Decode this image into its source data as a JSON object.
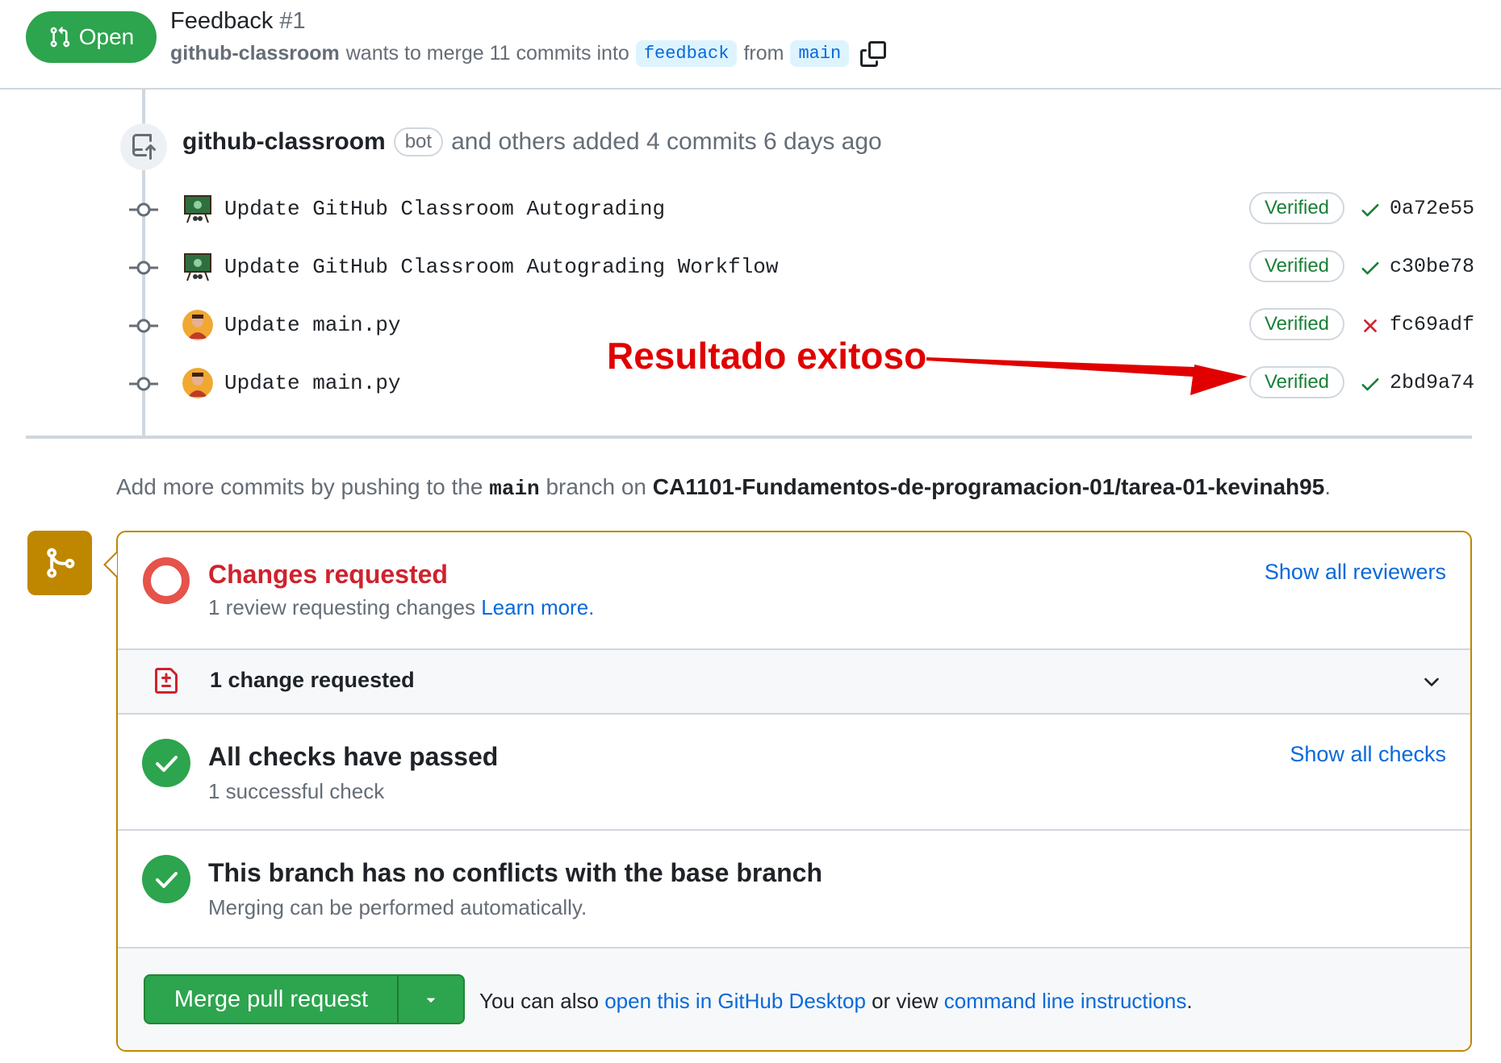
{
  "header": {
    "state_label": "Open",
    "title": "Feedback",
    "number": "#1",
    "author": "github-classroom",
    "meta_text": "wants to merge 11 commits into",
    "base_branch": "feedback",
    "from_text": "from",
    "head_branch": "main"
  },
  "timeline": {
    "push_author": "github-classroom",
    "bot_label": "bot",
    "push_summary": "and others added 4 commits 6 days ago",
    "commits": [
      {
        "message": "Update GitHub Classroom Autograding",
        "verified": "Verified",
        "status": "success",
        "sha": "0a72e55"
      },
      {
        "message": "Update GitHub Classroom Autograding Workflow",
        "verified": "Verified",
        "status": "success",
        "sha": "c30be78"
      },
      {
        "message": "Update main.py",
        "verified": "Verified",
        "status": "failure",
        "sha": "fc69adf"
      },
      {
        "message": "Update main.py",
        "verified": "Verified",
        "status": "success",
        "sha": "2bd9a74"
      }
    ]
  },
  "annotation": {
    "text": "Resultado exitoso",
    "color": "#e00000"
  },
  "add_more": {
    "prefix": "Add more commits by pushing to the",
    "branch": "main",
    "middle": "branch on",
    "repo": "CA1101-Fundamentos-de-programacion-01/tarea-01-kevinah95",
    "suffix": "."
  },
  "merge_box": {
    "review": {
      "title": "Changes requested",
      "subtitle": "1 review requesting changes",
      "learn_more": "Learn more.",
      "link": "Show all reviewers"
    },
    "change_requested": {
      "label": "1 change requested"
    },
    "checks": {
      "title": "All checks have passed",
      "subtitle": "1 successful check",
      "link": "Show all checks"
    },
    "conflicts": {
      "title": "This branch has no conflicts with the base branch",
      "subtitle": "Merging can be performed automatically."
    },
    "merge": {
      "button_label": "Merge pull request",
      "note_prefix": "You can also",
      "desktop_link": "open this in GitHub Desktop",
      "note_middle": "or view",
      "cli_link": "command line instructions",
      "note_suffix": "."
    }
  },
  "colors": {
    "open_green": "#2da44e",
    "verified_green": "#1a7f37",
    "failure_red": "#cf222e",
    "merge_accent": "#bf8700",
    "link_blue": "#0969da"
  },
  "icons": [
    "git-pull-request-icon",
    "copy-icon",
    "repo-push-icon",
    "git-commit-icon",
    "check-icon",
    "x-icon",
    "git-merge-icon",
    "file-diff-icon",
    "chevron-down-icon",
    "triangle-down-icon"
  ]
}
